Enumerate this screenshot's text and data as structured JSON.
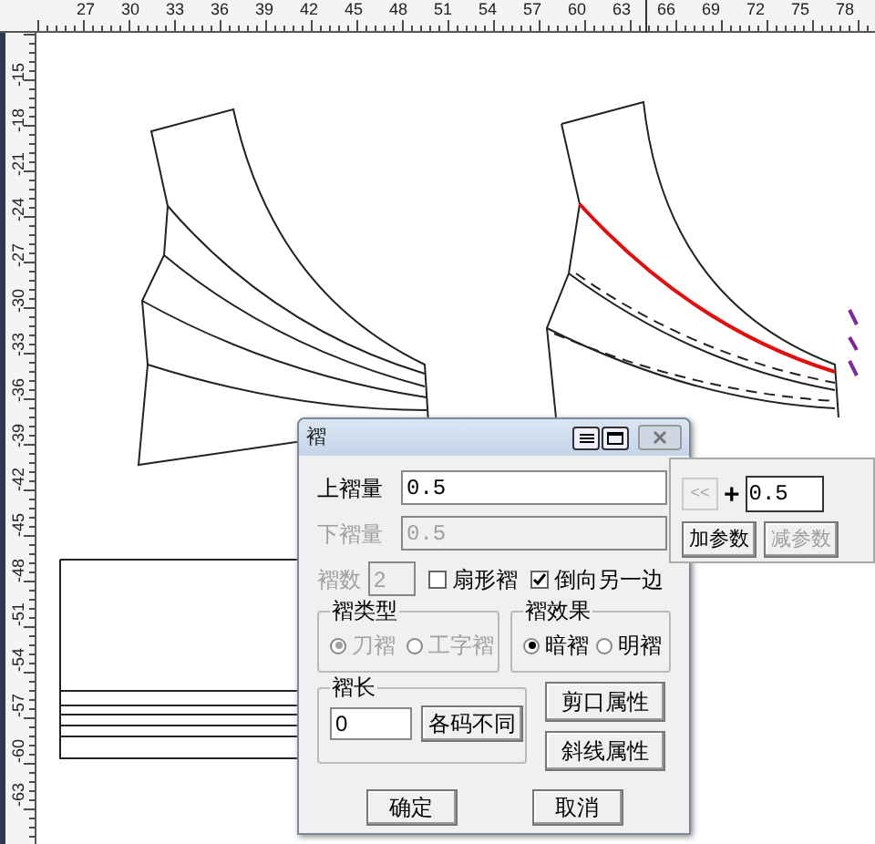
{
  "ruler_top": {
    "labels": [
      "27",
      "30",
      "33",
      "36",
      "39",
      "42",
      "45",
      "48",
      "51",
      "54",
      "57",
      "60",
      "63",
      "66",
      "69",
      "72",
      "75",
      "78"
    ]
  },
  "ruler_left": {
    "labels": [
      "-15",
      "-18",
      "-21",
      "-24",
      "-27",
      "-30",
      "-33",
      "-36",
      "-39",
      "-42",
      "-45",
      "-48",
      "-51",
      "-54",
      "-57",
      "-60",
      "-63"
    ]
  },
  "dialog": {
    "title": "褶",
    "upper_amount": {
      "label": "上褶量",
      "value": "0.5"
    },
    "lower_amount": {
      "label": "下褶量",
      "value": "0.5",
      "disabled": true
    },
    "count": {
      "label": "褶数",
      "value": "2",
      "disabled": true
    },
    "checkboxes": [
      {
        "label": "扇形褶",
        "checked": false
      },
      {
        "label": "倒向另一边",
        "checked": true
      }
    ],
    "type_group": {
      "title": "褶类型",
      "disabled": true,
      "options": [
        {
          "label": "刀褶",
          "selected": true
        },
        {
          "label": "工字褶",
          "selected": false
        }
      ]
    },
    "effect_group": {
      "title": "褶效果",
      "options": [
        {
          "label": "暗褶",
          "selected": true
        },
        {
          "label": "明褶",
          "selected": false
        }
      ]
    },
    "length_group": {
      "title": "褶长",
      "value": "0",
      "button": "各码不同"
    },
    "side_buttons": [
      "剪口属性",
      "斜线属性"
    ],
    "ok": "确定",
    "cancel": "取消"
  },
  "param_panel": {
    "back": "<<",
    "sign": "+",
    "value": "0.5",
    "buttons": [
      {
        "label": "加参数",
        "disabled": false
      },
      {
        "label": "减参数",
        "disabled": true
      }
    ]
  }
}
